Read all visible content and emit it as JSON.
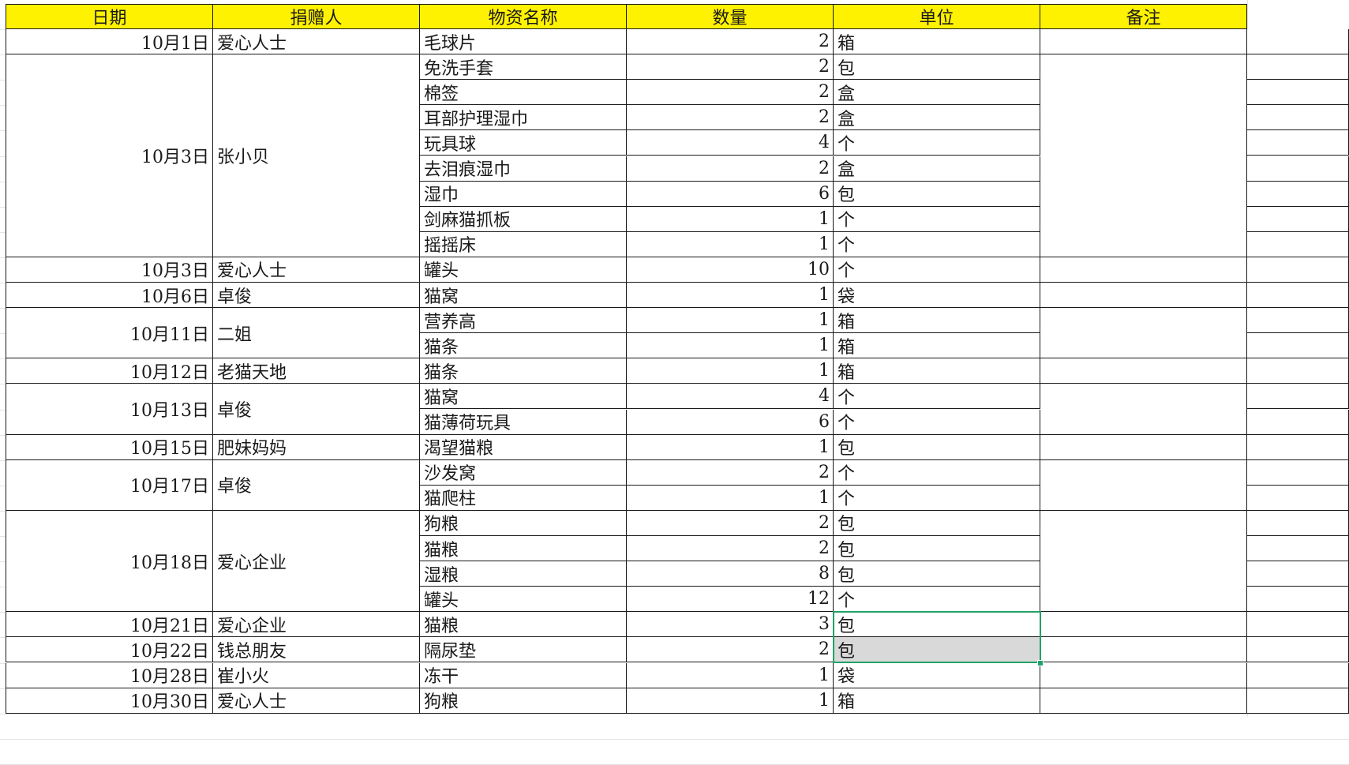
{
  "sheet": {
    "headers": [
      "日期",
      "捐赠人",
      "物资名称",
      "数量",
      "单位",
      "备注"
    ],
    "groups": [
      {
        "date": "10月1日",
        "donor": "爱心人士",
        "items": [
          {
            "name": "毛球片",
            "qty": "2",
            "unit": "箱"
          }
        ]
      },
      {
        "date": "10月3日",
        "donor": "张小贝",
        "items": [
          {
            "name": "免洗手套",
            "qty": "2",
            "unit": "包"
          },
          {
            "name": "棉签",
            "qty": "2",
            "unit": "盒"
          },
          {
            "name": "耳部护理湿巾",
            "qty": "2",
            "unit": "盒"
          },
          {
            "name": "玩具球",
            "qty": "4",
            "unit": "个"
          },
          {
            "name": "去泪痕湿巾",
            "qty": "2",
            "unit": "盒"
          },
          {
            "name": "湿巾",
            "qty": "6",
            "unit": "包"
          },
          {
            "name": "剑麻猫抓板",
            "qty": "1",
            "unit": "个"
          },
          {
            "name": "摇摇床",
            "qty": "1",
            "unit": "个"
          }
        ]
      },
      {
        "date": "10月3日",
        "donor": "爱心人士",
        "items": [
          {
            "name": "罐头",
            "qty": "10",
            "unit": "个"
          }
        ]
      },
      {
        "date": "10月6日",
        "donor": "卓俊",
        "items": [
          {
            "name": "猫窝",
            "qty": "1",
            "unit": "袋"
          }
        ]
      },
      {
        "date": "10月11日",
        "donor": "二姐",
        "items": [
          {
            "name": "营养高",
            "qty": "1",
            "unit": "箱"
          },
          {
            "name": "猫条",
            "qty": "1",
            "unit": "箱"
          }
        ]
      },
      {
        "date": "10月12日",
        "donor": "老猫天地",
        "items": [
          {
            "name": "猫条",
            "qty": "1",
            "unit": "箱"
          }
        ]
      },
      {
        "date": "10月13日",
        "donor": "卓俊",
        "items": [
          {
            "name": "猫窝",
            "qty": "4",
            "unit": "个"
          },
          {
            "name": "猫薄荷玩具",
            "qty": "6",
            "unit": "个"
          }
        ]
      },
      {
        "date": "10月15日",
        "donor": "肥妹妈妈",
        "items": [
          {
            "name": "渴望猫粮",
            "qty": "1",
            "unit": "包"
          }
        ]
      },
      {
        "date": "10月17日",
        "donor": "卓俊",
        "items": [
          {
            "name": "沙发窝",
            "qty": "2",
            "unit": "个"
          },
          {
            "name": "猫爬柱",
            "qty": "1",
            "unit": "个"
          }
        ]
      },
      {
        "date": "10月18日",
        "donor": "爱心企业",
        "items": [
          {
            "name": "狗粮",
            "qty": "2",
            "unit": "包"
          },
          {
            "name": "猫粮",
            "qty": "2",
            "unit": "包"
          },
          {
            "name": "湿粮",
            "qty": "8",
            "unit": "包"
          },
          {
            "name": "罐头",
            "qty": "12",
            "unit": "个"
          }
        ]
      },
      {
        "date": "10月21日",
        "donor": "爱心企业",
        "items": [
          {
            "name": "猫粮",
            "qty": "3",
            "unit": "包"
          }
        ]
      },
      {
        "date": "10月22日",
        "donor": "钱总朋友",
        "items": [
          {
            "name": "隔尿垫",
            "qty": "2",
            "unit": "包"
          }
        ]
      },
      {
        "date": "10月28日",
        "donor": "崔小火",
        "items": [
          {
            "name": "冻干",
            "qty": "1",
            "unit": "袋"
          }
        ]
      },
      {
        "date": "10月30日",
        "donor": "爱心人士",
        "items": [
          {
            "name": "狗粮",
            "qty": "1",
            "unit": "箱"
          }
        ]
      }
    ],
    "selection_colors": {
      "border": "#21a366",
      "fill": "#d9d9d9",
      "header_fill": "#fff200"
    }
  }
}
